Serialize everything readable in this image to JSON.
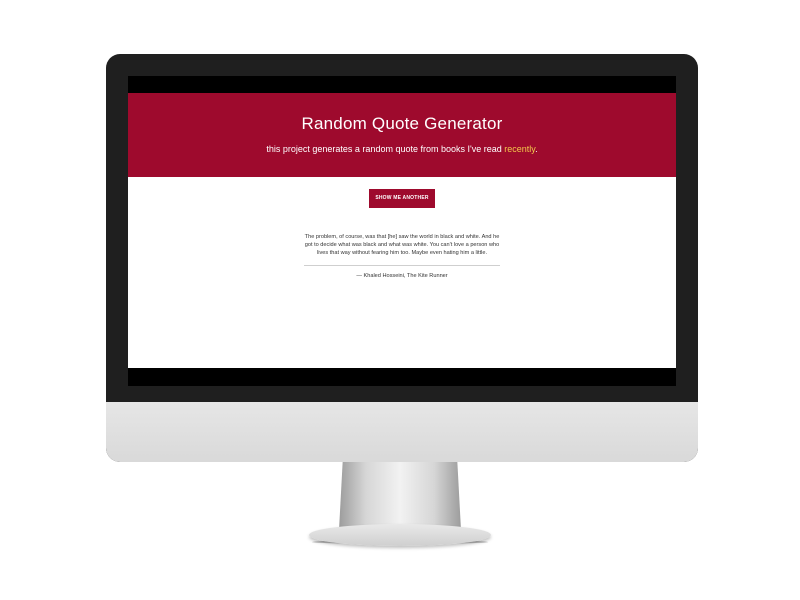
{
  "app": {
    "title": "Random Quote Generator",
    "subtitle_prefix": "this project generates a random quote from books I've read ",
    "subtitle_link": "recently",
    "subtitle_suffix": ".",
    "button_label": "SHOW ME ANOTHER"
  },
  "quote": {
    "text": "The problem, of course, was that [he] saw the world in black and white. And he got to decide what was black and what was white. You can't love a person who lives that way without fearing him too. Maybe even hating him a little.",
    "source": "— Khaled Hosseini, The Kite Runner"
  },
  "colors": {
    "brand": "#9e0a2d",
    "link": "#f3c74b"
  }
}
